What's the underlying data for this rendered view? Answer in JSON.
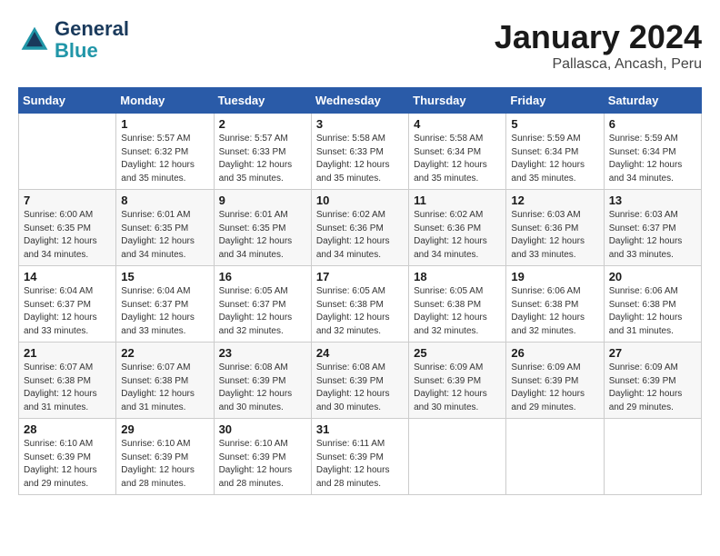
{
  "header": {
    "logo_line1": "General",
    "logo_line2": "Blue",
    "month": "January 2024",
    "location": "Pallasca, Ancash, Peru"
  },
  "days_of_week": [
    "Sunday",
    "Monday",
    "Tuesday",
    "Wednesday",
    "Thursday",
    "Friday",
    "Saturday"
  ],
  "weeks": [
    [
      {
        "day": "",
        "sunrise": "",
        "sunset": "",
        "daylight": ""
      },
      {
        "day": "1",
        "sunrise": "Sunrise: 5:57 AM",
        "sunset": "Sunset: 6:32 PM",
        "daylight": "Daylight: 12 hours and 35 minutes."
      },
      {
        "day": "2",
        "sunrise": "Sunrise: 5:57 AM",
        "sunset": "Sunset: 6:33 PM",
        "daylight": "Daylight: 12 hours and 35 minutes."
      },
      {
        "day": "3",
        "sunrise": "Sunrise: 5:58 AM",
        "sunset": "Sunset: 6:33 PM",
        "daylight": "Daylight: 12 hours and 35 minutes."
      },
      {
        "day": "4",
        "sunrise": "Sunrise: 5:58 AM",
        "sunset": "Sunset: 6:34 PM",
        "daylight": "Daylight: 12 hours and 35 minutes."
      },
      {
        "day": "5",
        "sunrise": "Sunrise: 5:59 AM",
        "sunset": "Sunset: 6:34 PM",
        "daylight": "Daylight: 12 hours and 35 minutes."
      },
      {
        "day": "6",
        "sunrise": "Sunrise: 5:59 AM",
        "sunset": "Sunset: 6:34 PM",
        "daylight": "Daylight: 12 hours and 34 minutes."
      }
    ],
    [
      {
        "day": "7",
        "sunrise": "Sunrise: 6:00 AM",
        "sunset": "Sunset: 6:35 PM",
        "daylight": "Daylight: 12 hours and 34 minutes."
      },
      {
        "day": "8",
        "sunrise": "Sunrise: 6:01 AM",
        "sunset": "Sunset: 6:35 PM",
        "daylight": "Daylight: 12 hours and 34 minutes."
      },
      {
        "day": "9",
        "sunrise": "Sunrise: 6:01 AM",
        "sunset": "Sunset: 6:35 PM",
        "daylight": "Daylight: 12 hours and 34 minutes."
      },
      {
        "day": "10",
        "sunrise": "Sunrise: 6:02 AM",
        "sunset": "Sunset: 6:36 PM",
        "daylight": "Daylight: 12 hours and 34 minutes."
      },
      {
        "day": "11",
        "sunrise": "Sunrise: 6:02 AM",
        "sunset": "Sunset: 6:36 PM",
        "daylight": "Daylight: 12 hours and 34 minutes."
      },
      {
        "day": "12",
        "sunrise": "Sunrise: 6:03 AM",
        "sunset": "Sunset: 6:36 PM",
        "daylight": "Daylight: 12 hours and 33 minutes."
      },
      {
        "day": "13",
        "sunrise": "Sunrise: 6:03 AM",
        "sunset": "Sunset: 6:37 PM",
        "daylight": "Daylight: 12 hours and 33 minutes."
      }
    ],
    [
      {
        "day": "14",
        "sunrise": "Sunrise: 6:04 AM",
        "sunset": "Sunset: 6:37 PM",
        "daylight": "Daylight: 12 hours and 33 minutes."
      },
      {
        "day": "15",
        "sunrise": "Sunrise: 6:04 AM",
        "sunset": "Sunset: 6:37 PM",
        "daylight": "Daylight: 12 hours and 33 minutes."
      },
      {
        "day": "16",
        "sunrise": "Sunrise: 6:05 AM",
        "sunset": "Sunset: 6:37 PM",
        "daylight": "Daylight: 12 hours and 32 minutes."
      },
      {
        "day": "17",
        "sunrise": "Sunrise: 6:05 AM",
        "sunset": "Sunset: 6:38 PM",
        "daylight": "Daylight: 12 hours and 32 minutes."
      },
      {
        "day": "18",
        "sunrise": "Sunrise: 6:05 AM",
        "sunset": "Sunset: 6:38 PM",
        "daylight": "Daylight: 12 hours and 32 minutes."
      },
      {
        "day": "19",
        "sunrise": "Sunrise: 6:06 AM",
        "sunset": "Sunset: 6:38 PM",
        "daylight": "Daylight: 12 hours and 32 minutes."
      },
      {
        "day": "20",
        "sunrise": "Sunrise: 6:06 AM",
        "sunset": "Sunset: 6:38 PM",
        "daylight": "Daylight: 12 hours and 31 minutes."
      }
    ],
    [
      {
        "day": "21",
        "sunrise": "Sunrise: 6:07 AM",
        "sunset": "Sunset: 6:38 PM",
        "daylight": "Daylight: 12 hours and 31 minutes."
      },
      {
        "day": "22",
        "sunrise": "Sunrise: 6:07 AM",
        "sunset": "Sunset: 6:38 PM",
        "daylight": "Daylight: 12 hours and 31 minutes."
      },
      {
        "day": "23",
        "sunrise": "Sunrise: 6:08 AM",
        "sunset": "Sunset: 6:39 PM",
        "daylight": "Daylight: 12 hours and 30 minutes."
      },
      {
        "day": "24",
        "sunrise": "Sunrise: 6:08 AM",
        "sunset": "Sunset: 6:39 PM",
        "daylight": "Daylight: 12 hours and 30 minutes."
      },
      {
        "day": "25",
        "sunrise": "Sunrise: 6:09 AM",
        "sunset": "Sunset: 6:39 PM",
        "daylight": "Daylight: 12 hours and 30 minutes."
      },
      {
        "day": "26",
        "sunrise": "Sunrise: 6:09 AM",
        "sunset": "Sunset: 6:39 PM",
        "daylight": "Daylight: 12 hours and 29 minutes."
      },
      {
        "day": "27",
        "sunrise": "Sunrise: 6:09 AM",
        "sunset": "Sunset: 6:39 PM",
        "daylight": "Daylight: 12 hours and 29 minutes."
      }
    ],
    [
      {
        "day": "28",
        "sunrise": "Sunrise: 6:10 AM",
        "sunset": "Sunset: 6:39 PM",
        "daylight": "Daylight: 12 hours and 29 minutes."
      },
      {
        "day": "29",
        "sunrise": "Sunrise: 6:10 AM",
        "sunset": "Sunset: 6:39 PM",
        "daylight": "Daylight: 12 hours and 28 minutes."
      },
      {
        "day": "30",
        "sunrise": "Sunrise: 6:10 AM",
        "sunset": "Sunset: 6:39 PM",
        "daylight": "Daylight: 12 hours and 28 minutes."
      },
      {
        "day": "31",
        "sunrise": "Sunrise: 6:11 AM",
        "sunset": "Sunset: 6:39 PM",
        "daylight": "Daylight: 12 hours and 28 minutes."
      },
      {
        "day": "",
        "sunrise": "",
        "sunset": "",
        "daylight": ""
      },
      {
        "day": "",
        "sunrise": "",
        "sunset": "",
        "daylight": ""
      },
      {
        "day": "",
        "sunrise": "",
        "sunset": "",
        "daylight": ""
      }
    ]
  ]
}
